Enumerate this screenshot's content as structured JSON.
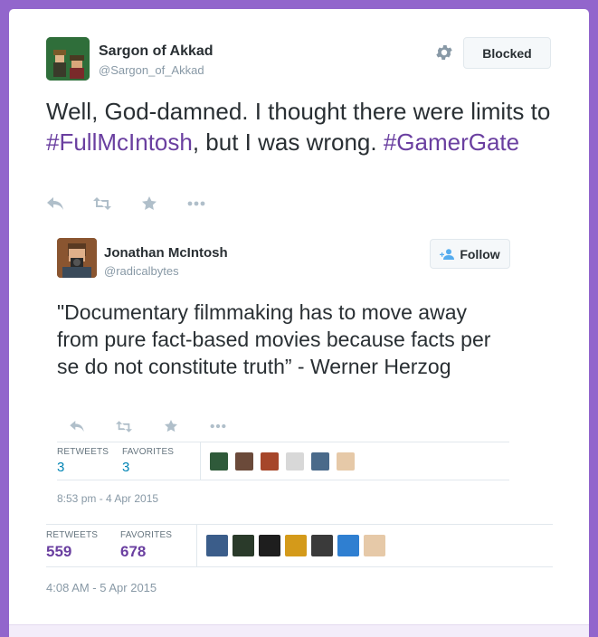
{
  "tweet": {
    "author_name": "Sargon of Akkad",
    "author_handle": "@Sargon_of_Akkad",
    "blocked_label": "Blocked",
    "text_before": "Well, God-damned. I thought there were limits to ",
    "hashtag1": "#FullMcIntosh",
    "text_middle": ", but I was wrong. ",
    "hashtag2": "#GamerGate",
    "retweets_label": "RETWEETS",
    "retweets_count": "559",
    "favorites_label": "FAVORITES",
    "favorites_count": "678",
    "timestamp": "4:08 AM - 5 Apr 2015",
    "favoriter_avatar_colors": [
      "#3b5d8a",
      "#2a3a2a",
      "#1e1e1e",
      "#d49a1a",
      "#3a3a3a",
      "#2f7fd1",
      "#e6c9a8"
    ]
  },
  "quoted": {
    "author_name": "Jonathan McIntosh",
    "author_handle": "@radicalbytes",
    "follow_label": "Follow",
    "text": "\"Documentary filmmaking has to move away from pure fact-based movies because facts per se do not constitute truth” - Werner Herzog",
    "retweets_label": "RETWEETS",
    "retweets_count": "3",
    "favorites_label": "FAVORITES",
    "favorites_count": "3",
    "timestamp": "8:53 pm - 4 Apr 2015",
    "favoriter_avatar_colors": [
      "#2f5a3a",
      "#6b4a3a",
      "#a6462a",
      "#d8d8d8",
      "#4a6a8a",
      "#e6c9a8"
    ]
  },
  "icons": {
    "settings": "gear-icon",
    "reply": "reply-icon",
    "retweet": "retweet-icon",
    "favorite": "star-icon",
    "more": "more-icon",
    "follow": "add-user-icon"
  },
  "colors": {
    "background": "#9266cc",
    "hashtag": "#6a3fa0",
    "stat_link": "#0084b4"
  }
}
